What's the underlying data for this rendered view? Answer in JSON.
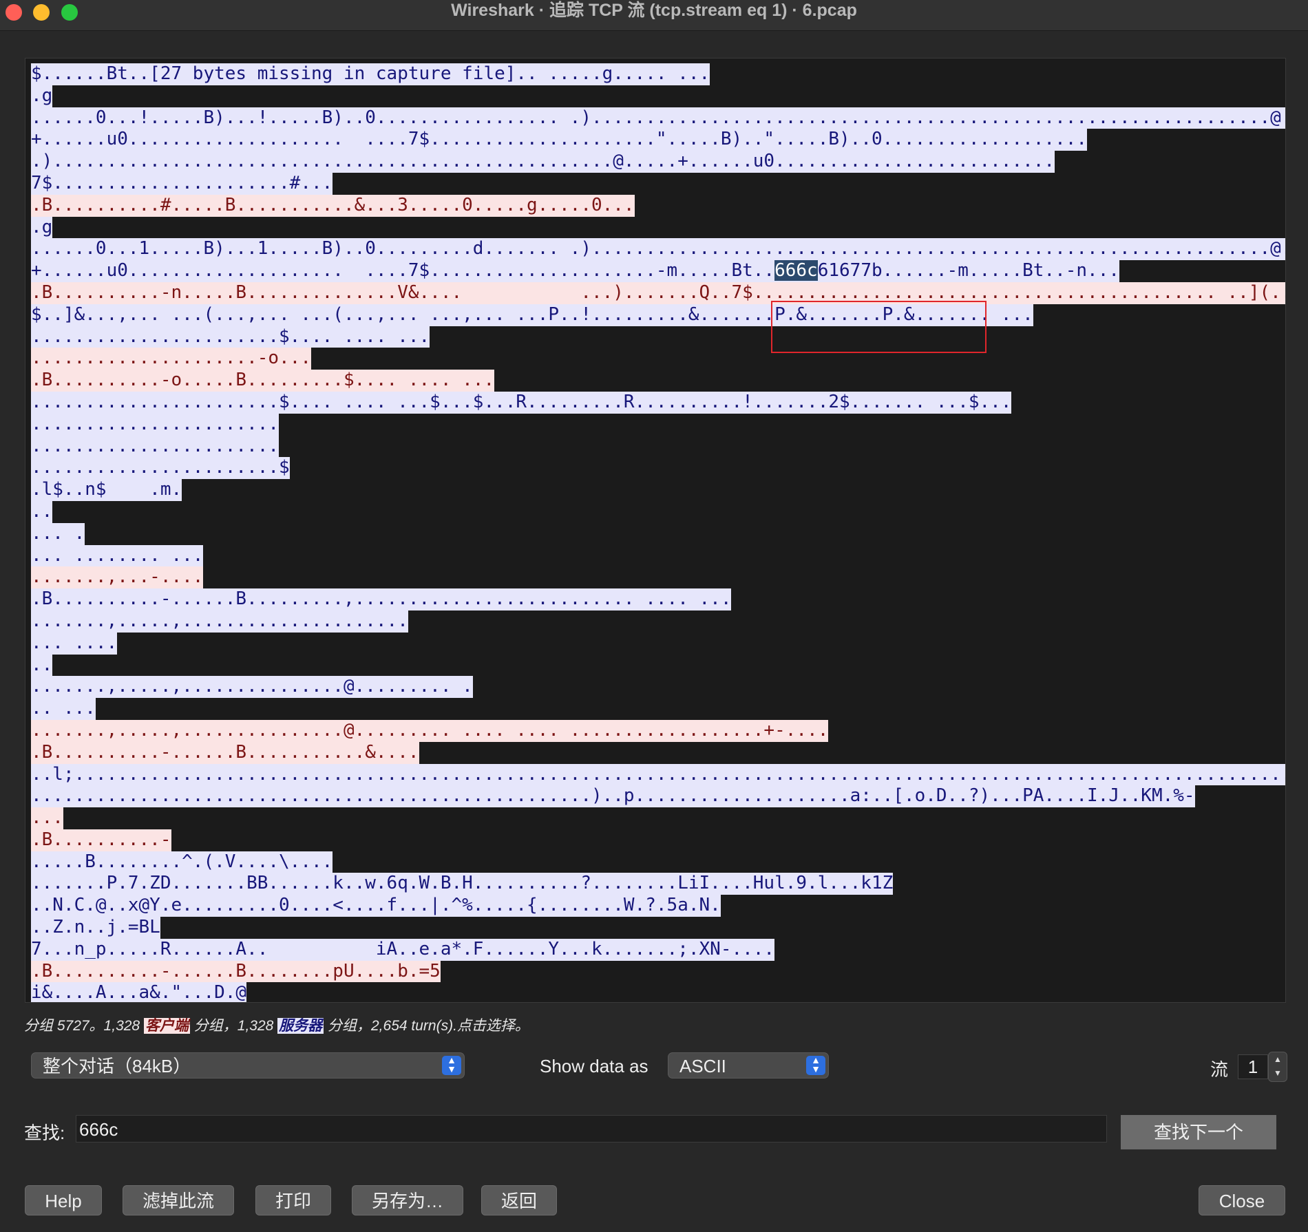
{
  "window": {
    "title": "Wireshark · 追踪 TCP 流 (tcp.stream eq 1) · 6.pcap"
  },
  "stream": {
    "lines": [
      {
        "who": "s",
        "text": "$......Bt..[27 bytes missing in capture file].. .....g..... ..."
      },
      {
        "who": "s",
        "text": ".g"
      },
      {
        "who": "s",
        "text": "......0...!.....B)...!.....B)..0................. .)...............................................................@....."
      },
      {
        "who": "s",
        "text": "+......u0....................  ....7$.....................\".....B)..\".....B)..0..................."
      },
      {
        "who": "s",
        "text": ".)....................................................@.....+......u0.........................."
      },
      {
        "who": "s",
        "text": "7$......................#..."
      },
      {
        "who": "c",
        "text": ".B..........#.....B...........&...3.....0.....g.....0..."
      },
      {
        "who": "s",
        "text": ".g"
      },
      {
        "who": "s",
        "text": "......0...1.....B)...1.....B)..0.........d....... .)...............................................................@....."
      },
      {
        "who": "s",
        "text": "+......u0....................  ....7$.....................-m.....Bt..",
        "hl": "666c",
        "tail": "61677b......-m.....Bt..-n..."
      },
      {
        "who": "c",
        "text": ".B..........-n.....B..............V&....           ...).......Q..7$........................................... ..](..."
      },
      {
        "who": "s",
        "text": "$..]&...,... ...(...,... ...(...,... ...,... ...P..!.........&.......P.&.......P.&....... ..."
      },
      {
        "who": "s",
        "text": ".......................$.... .... ..."
      },
      {
        "who": "c",
        "text": ".....................-o..."
      },
      {
        "who": "c",
        "text": ".B..........-o.....B.........$.... .... ..."
      },
      {
        "who": "s",
        "text": ".......................$.... .... ...$...$...R.........R..........!.......2$....... ...$..."
      },
      {
        "who": "s",
        "text": "......................."
      },
      {
        "who": "s",
        "text": "......................."
      },
      {
        "who": "s",
        "text": ".......................$"
      },
      {
        "who": "s",
        "text": ".l$..n$    .m."
      },
      {
        "who": "s",
        "text": ".."
      },
      {
        "who": "s",
        "text": "... ."
      },
      {
        "who": "s",
        "text": "... ........ ..."
      },
      {
        "who": "c",
        "text": ".......,...-...."
      },
      {
        "who": "s",
        "text": ".B..........-......B.........,.......................... .... ..."
      },
      {
        "who": "s",
        "text": ".......,.....,....................."
      },
      {
        "who": "s",
        "text": "... ...."
      },
      {
        "who": "s",
        "text": ".."
      },
      {
        "who": "s",
        "text": ".......,.....,...............@......... ."
      },
      {
        "who": "s",
        "text": ".. ..."
      },
      {
        "who": "c",
        "text": ".......,.....,...............@......... .... .... ..................+-...."
      },
      {
        "who": "c",
        "text": ".B..........-......B...........&...."
      },
      {
        "who": "s",
        "text": "..l;......................................................................................................................."
      },
      {
        "who": "s",
        "text": "....................................................)..p....................a:..[.o.D..?)...PA....I.J..KM.%-"
      },
      {
        "who": "c",
        "text": "..."
      },
      {
        "who": "c",
        "text": ".B..........-"
      },
      {
        "who": "s",
        "text": ".....B........^.(.V....\\...."
      },
      {
        "who": "s",
        "text": ".......P.7.ZD.......BB......k..w.6q.W.B.H..........?........LiI....Hul.9.l...k1Z"
      },
      {
        "who": "s",
        "text": "..N.C.@..x@Y.e.........0....<....f...|.^%.....{........W.?.5a.N."
      },
      {
        "who": "s",
        "text": "..Z.n..j.=BL"
      },
      {
        "who": "s",
        "text": "7...n_p.....R......A..          iA..e.a*.F......Y...k.......;.XN-...."
      },
      {
        "who": "c",
        "text": ".B..........-......B........pU....b.=5"
      },
      {
        "who": "s",
        "text": "i&....A...a&.\"...D.@"
      }
    ]
  },
  "summary": {
    "prefix": "分组 5727。1,328 ",
    "client": "客户端",
    "mid": " 分组，1,328 ",
    "server": "服务器",
    "suffix": " 分组，2,654 turn(s).点击选择。"
  },
  "controls": {
    "conversation": "整个对话（84kB）",
    "show_as_label": "Show data as",
    "show_as_value": "ASCII",
    "stream_label": "流",
    "stream_value": "1"
  },
  "find": {
    "label": "查找:",
    "value": "666c",
    "next": "查找下一个"
  },
  "buttons": {
    "help": "Help",
    "filter": "滤掉此流",
    "print": "打印",
    "save": "另存为…",
    "back": "返回",
    "close": "Close"
  },
  "colors": {
    "client_bg": "#fbe4e4",
    "client_fg": "#7c1515",
    "server_bg": "#e6e6fb",
    "server_fg": "#17177a",
    "match": "#e0262b"
  }
}
